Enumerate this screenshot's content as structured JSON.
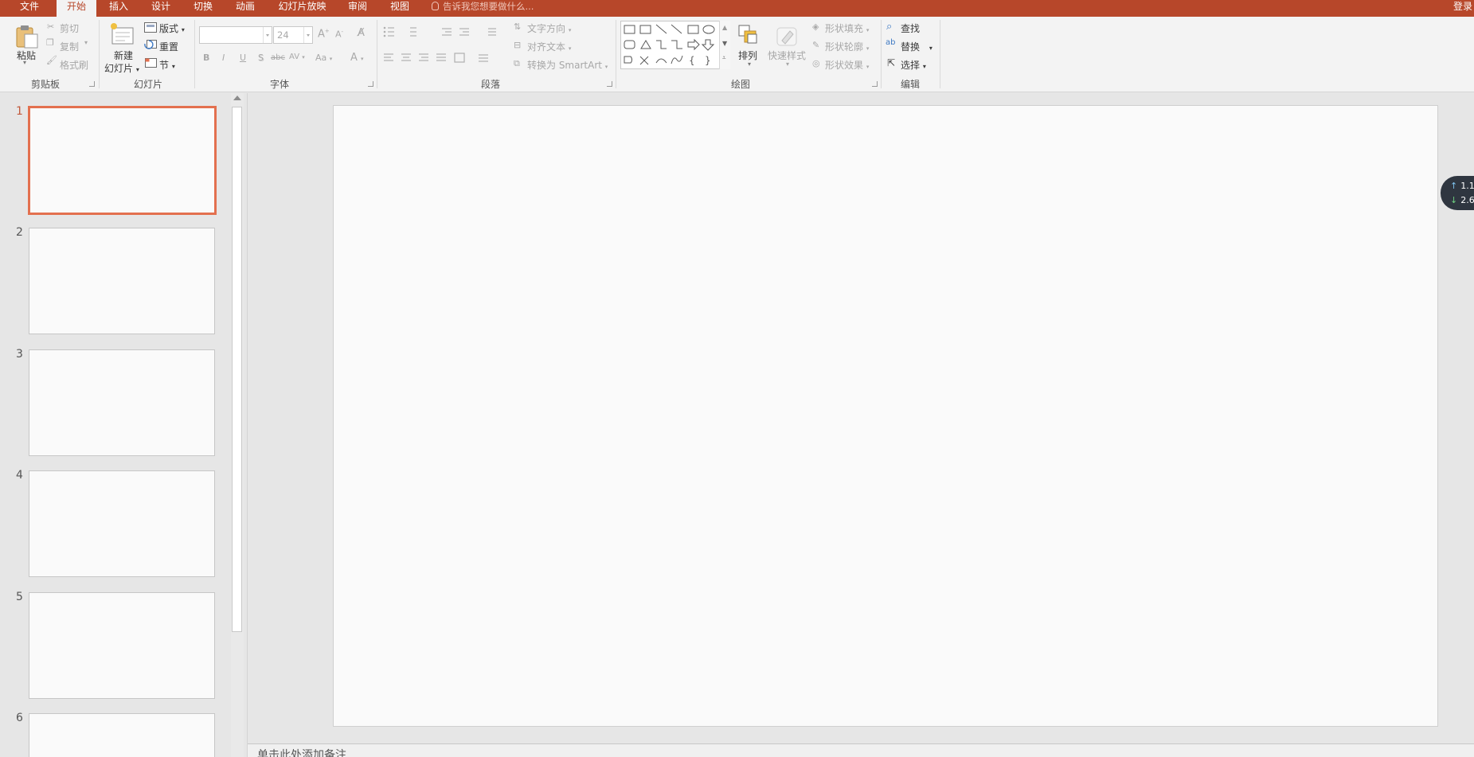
{
  "tabs": [
    {
      "label": "文件",
      "active": false
    },
    {
      "label": "开始",
      "active": true
    },
    {
      "label": "插入",
      "active": false
    },
    {
      "label": "设计",
      "active": false
    },
    {
      "label": "切换",
      "active": false
    },
    {
      "label": "动画",
      "active": false
    },
    {
      "label": "幻灯片放映",
      "active": false
    },
    {
      "label": "审阅",
      "active": false
    },
    {
      "label": "视图",
      "active": false
    }
  ],
  "tellme_placeholder": "告诉我您想要做什么...",
  "login_label": "登录",
  "ribbon": {
    "clipboard": {
      "group": "剪贴板",
      "paste": "粘贴",
      "cut": "剪切",
      "copy": "复制",
      "format_painter": "格式刷"
    },
    "slides": {
      "group": "幻灯片",
      "new_slide_1": "新建",
      "new_slide_2": "幻灯片",
      "layout": "版式",
      "reset": "重置",
      "section": "节"
    },
    "font": {
      "group": "字体",
      "font_name": "",
      "font_size": "24",
      "bold": "B",
      "italic": "I",
      "underline": "U",
      "shadow": "S",
      "strike": "abc",
      "spacing": "AV",
      "case": "Aa",
      "color": "A"
    },
    "paragraph": {
      "group": "段落",
      "text_direction": "文字方向",
      "align_text": "对齐文本",
      "convert_smartart": "转换为 SmartArt"
    },
    "drawing": {
      "group": "绘图",
      "arrange": "排列",
      "quick_styles": "快速样式",
      "shape_fill": "形状填充",
      "shape_outline": "形状轮廓",
      "shape_effects": "形状效果"
    },
    "editing": {
      "group": "编辑",
      "find": "查找",
      "replace": "替换",
      "select": "选择"
    }
  },
  "slides": [
    {
      "number": "1",
      "selected": true
    },
    {
      "number": "2",
      "selected": false
    },
    {
      "number": "3",
      "selected": false
    },
    {
      "number": "4",
      "selected": false
    },
    {
      "number": "5",
      "selected": false
    },
    {
      "number": "6",
      "selected": false
    }
  ],
  "notes_placeholder": "单击此处添加备注",
  "net_widget": {
    "upload": "1.1",
    "download": "2.6"
  },
  "colors": {
    "accent": "#b7472a",
    "selection": "#e3704f"
  }
}
